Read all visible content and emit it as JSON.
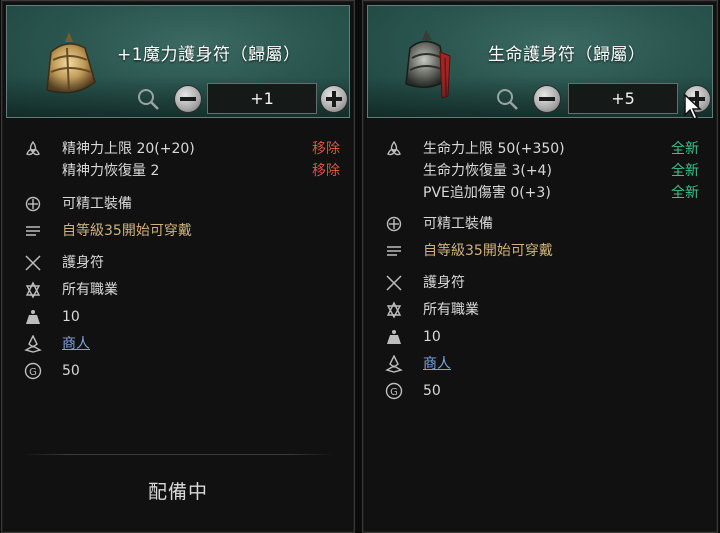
{
  "left": {
    "item_name": "+1魔力護身符（歸屬）",
    "enhance_value": "+1",
    "stats": [
      {
        "text": "精神力上限 20(+20)",
        "tag": "移除"
      },
      {
        "text": "精神力恢復量 2",
        "tag": "移除"
      }
    ],
    "craftable": "可精工裝備",
    "level_req": "自等級35開始可穿戴",
    "item_type": "護身符",
    "classes": "所有職業",
    "weight": "10",
    "source": "商人",
    "price": "50",
    "status": "配備中"
  },
  "right": {
    "item_name": "生命護身符（歸屬）",
    "enhance_value": "+5",
    "stats": [
      {
        "text": "生命力上限 50(+350)",
        "tag": "全新"
      },
      {
        "text": "生命力恢復量 3(+4)",
        "tag": "全新"
      },
      {
        "text": "PVE追加傷害 0(+3)",
        "tag": "全新"
      }
    ],
    "craftable": "可精工裝備",
    "level_req": "自等級35開始可穿戴",
    "item_type": "護身符",
    "classes": "所有職業",
    "weight": "10",
    "source": "商人",
    "price": "50"
  },
  "colors": {
    "header_teal": "#2b5750",
    "removed_red": "#d8554a",
    "new_green": "#3ec08a",
    "level_gold": "#d0b27a",
    "link_blue": "#7ea4dd"
  },
  "icons": [
    "amulet-gold-icon",
    "amulet-red-tassel-icon",
    "search-icon",
    "minus-icon",
    "plus-icon",
    "triquetra-stat-icon",
    "crosshair-craft-icon",
    "lines-level-icon",
    "crossed-swords-icon",
    "class-emblem-icon",
    "weight-icon",
    "source-icon",
    "gold-coin-icon",
    "mouse-cursor-icon"
  ]
}
